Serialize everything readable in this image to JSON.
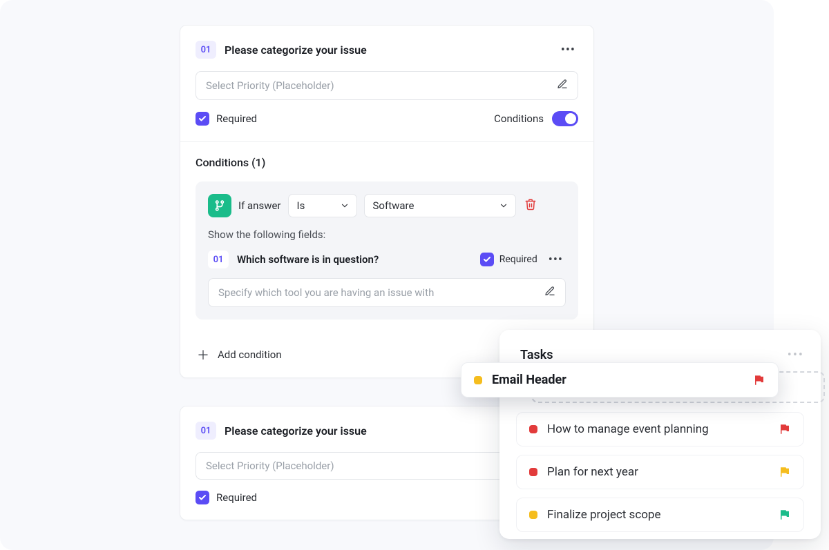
{
  "card1": {
    "num": "01",
    "title": "Please categorize your issue",
    "placeholder": "Select Priority (Placeholder)",
    "required_label": "Required",
    "conditions_label": "Conditions",
    "conditions_title": "Conditions (1)",
    "rule": {
      "prefix": "If answer",
      "op": "Is",
      "value": "Software"
    },
    "show_label": "Show the following fields:",
    "sub": {
      "num": "01",
      "title": "Which software is in question?",
      "placeholder": "Specify which tool you are having an issue with",
      "required_label": "Required"
    },
    "add_condition": "Add condition"
  },
  "card2": {
    "num": "01",
    "title": "Please categorize your issue",
    "placeholder": "Select Priority (Placeholder)",
    "required_label": "Required"
  },
  "tasks": {
    "title": "Tasks",
    "drag": {
      "name": "Email Header",
      "dot_color": "#f5bd1e",
      "flag_color": "#e23b3b"
    },
    "items": [
      {
        "name": "How to manage event planning",
        "dot_color": "#e23b3b",
        "flag_color": "#e23b3b"
      },
      {
        "name": "Plan for next year",
        "dot_color": "#e23b3b",
        "flag_color": "#f5bd1e"
      },
      {
        "name": "Finalize project scope",
        "dot_color": "#f5bd1e",
        "flag_color": "#1abc8a"
      }
    ]
  }
}
